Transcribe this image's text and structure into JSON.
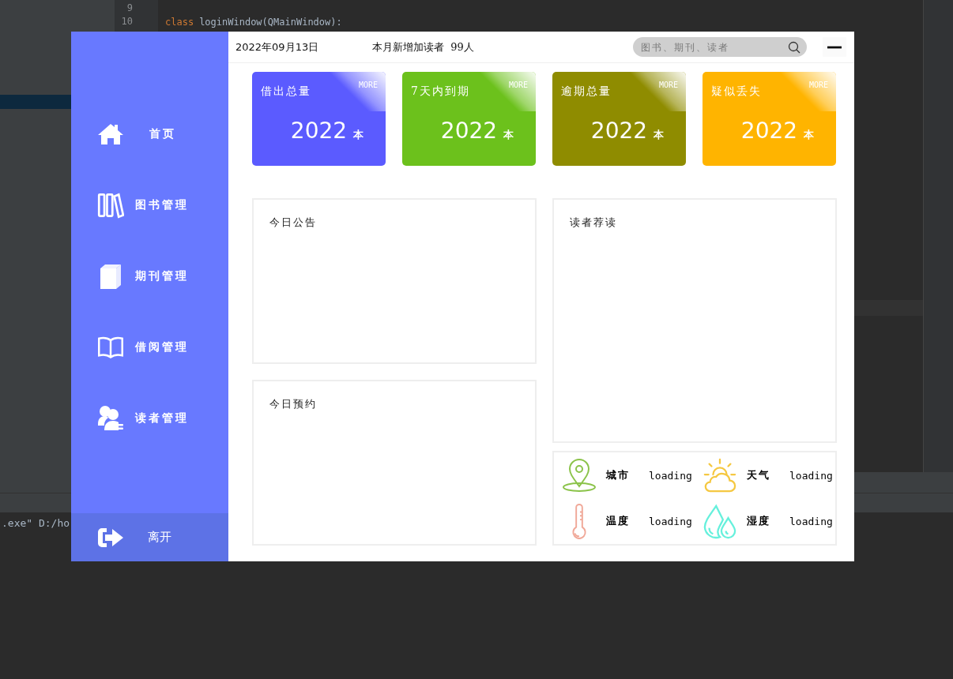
{
  "ide": {
    "line_numbers": [
      "9",
      "10"
    ],
    "code": [
      {
        "kind": "keyword",
        "text": "class"
      },
      {
        "kind": "name",
        "text": "loginWindow(QMainWindow):"
      }
    ],
    "terminal_text": ".exe\" D:/ho"
  },
  "sidebar": {
    "items": [
      {
        "label": "首页",
        "kind": "home"
      },
      {
        "label": "图书管理",
        "kind": "books"
      },
      {
        "label": "期刊管理",
        "kind": "journals"
      },
      {
        "label": "借阅管理",
        "kind": "open-book"
      },
      {
        "label": "读者管理",
        "kind": "readers"
      }
    ],
    "exit": {
      "label": "离开"
    }
  },
  "header": {
    "date": "2022年09月13日",
    "new_readers": "本月新增加读者  99人",
    "search": {
      "placeholder": "图书、期刊、读者"
    }
  },
  "stat_cards": [
    {
      "title": "借出总量",
      "more": "MORE",
      "value": "2022",
      "unit": "本",
      "color": "#5b5bff"
    },
    {
      "title": "7天内到期",
      "more": "MORE",
      "value": "2022",
      "unit": "本",
      "color": "#6cc11c"
    },
    {
      "title": "逾期总量",
      "more": "MORE",
      "value": "2022",
      "unit": "本",
      "color": "#8f8c00"
    },
    {
      "title": "疑似丢失",
      "more": "MORE",
      "value": "2022",
      "unit": "本",
      "color": "#ffb400"
    }
  ],
  "panels": [
    {
      "title": "今日公告"
    },
    {
      "title": "今日预约"
    },
    {
      "title": "读者荐读"
    }
  ],
  "weather": [
    {
      "kind": "location",
      "label": "城市",
      "value": "loading"
    },
    {
      "kind": "weather",
      "label": "天气",
      "value": "loading"
    },
    {
      "kind": "temperature",
      "label": "温度",
      "value": "loading"
    },
    {
      "kind": "humidity",
      "label": "湿度",
      "value": "loading"
    }
  ]
}
